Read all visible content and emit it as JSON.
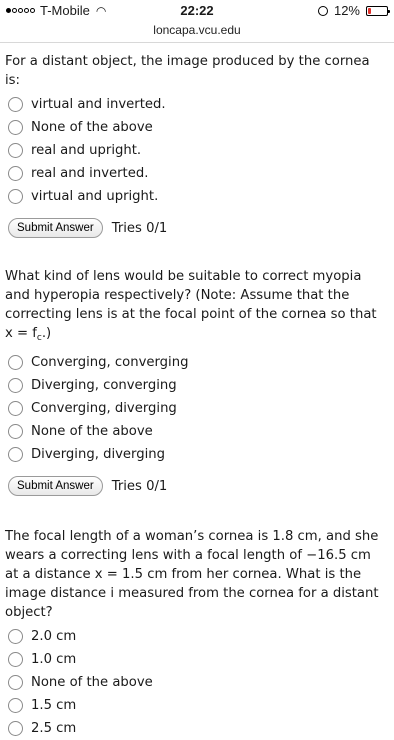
{
  "status_bar": {
    "carrier": "T-Mobile",
    "time": "22:22",
    "battery": "12%"
  },
  "url": "loncapa.vcu.edu",
  "questions": [
    {
      "text": "For a distant object, the image produced by the cornea is:",
      "options": [
        "virtual and inverted.",
        "None of the above",
        "real and upright.",
        "real and inverted.",
        "virtual and upright."
      ],
      "submit_label": "Submit Answer",
      "tries": "Tries 0/1"
    },
    {
      "text_before_sub": "What kind of lens would be suitable to correct myopia and hyperopia respectively? (Note: Assume that the correcting lens is at the focal point of the cornea so that x = f",
      "text_sub": "c",
      "text_after_sub": ".)",
      "options": [
        "Converging, converging",
        "Diverging, converging",
        "Converging, diverging",
        "None of the above",
        "Diverging, diverging"
      ],
      "submit_label": "Submit Answer",
      "tries": "Tries 0/1"
    },
    {
      "text": "The focal length of a woman’s cornea is 1.8 cm, and she wears a correcting lens with a focal length of −16.5 cm at a distance x = 1.5 cm from her cornea. What is the image distance i measured from the cornea for a distant object?",
      "options": [
        "2.0 cm",
        "1.0 cm",
        "None of the above",
        "1.5 cm",
        "2.5 cm"
      ]
    }
  ]
}
